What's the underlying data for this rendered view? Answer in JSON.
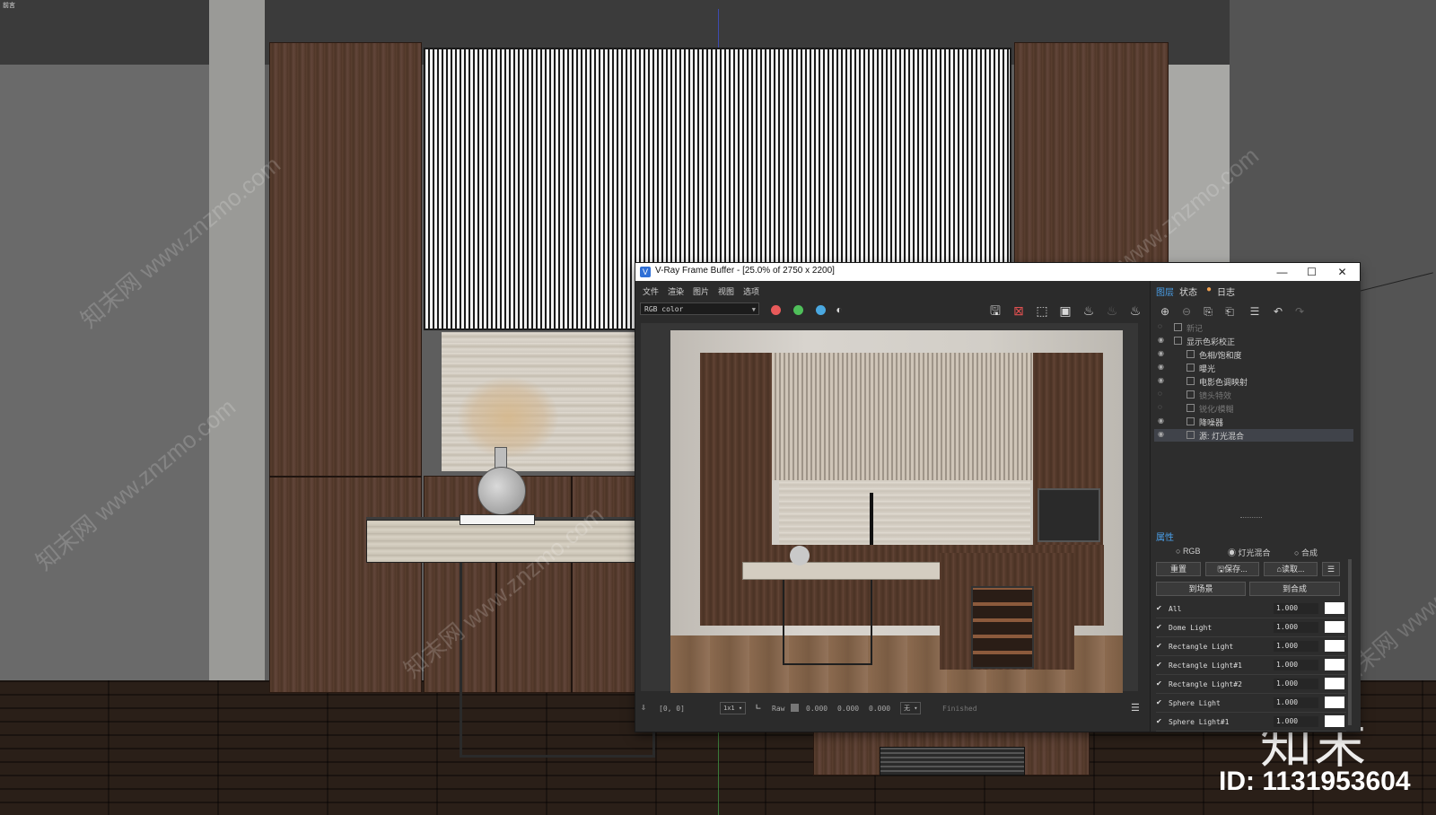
{
  "viewport": {
    "corner_label": "前言",
    "watermark_text": "知末网 www.znzmo.com",
    "logo_text": "知末",
    "id_text": "ID: 1131953604"
  },
  "vfb": {
    "title": "V-Ray Frame Buffer - [25.0% of 2750 x 2200]",
    "window_controls": {
      "minimize": "—",
      "maximize": "☐",
      "close": "✕"
    },
    "menu": [
      "文件",
      "渲染",
      "图片",
      "视图",
      "选项"
    ],
    "channel": "RGB color",
    "channel_dots": [
      "#e85a5a",
      "#4fbf5a",
      "#4aa8e0"
    ],
    "status": {
      "coords": "[0, 0]",
      "ratio": "1x1",
      "raw": "Raw",
      "v1": "0.000",
      "v2": "0.000",
      "v3": "0.000",
      "mode": "无",
      "state": "Finished"
    },
    "panel": {
      "tabs": [
        "图层",
        "状态",
        "日志"
      ],
      "layers": [
        {
          "name": "新记",
          "enabled": false,
          "indent": 1
        },
        {
          "name": "显示色彩校正",
          "enabled": true,
          "indent": 1
        },
        {
          "name": "色相/饱和度",
          "enabled": true,
          "indent": 2
        },
        {
          "name": "曝光",
          "enabled": true,
          "indent": 2
        },
        {
          "name": "电影色调映射",
          "enabled": true,
          "indent": 2
        },
        {
          "name": "镜头特效",
          "enabled": false,
          "indent": 2
        },
        {
          "name": "锐化/模糊",
          "enabled": false,
          "indent": 2
        },
        {
          "name": "降噪器",
          "enabled": true,
          "indent": 2
        },
        {
          "name": "源: 灯光混合",
          "enabled": true,
          "indent": 2,
          "selected": true
        }
      ],
      "properties_title": "属性",
      "radio": [
        "RGB",
        "灯光混合",
        "合成"
      ],
      "radio_selected": "灯光混合",
      "buttons": {
        "reset": "重置",
        "save": "保存...",
        "load": "读取...",
        "to_scene": "到场景",
        "to_composite": "到合成"
      },
      "lights": [
        {
          "name": "All",
          "value": "1.000"
        },
        {
          "name": "Dome Light",
          "value": "1.000"
        },
        {
          "name": "Rectangle Light",
          "value": "1.000"
        },
        {
          "name": "Rectangle Light#1",
          "value": "1.000"
        },
        {
          "name": "Rectangle Light#2",
          "value": "1.000"
        },
        {
          "name": "Sphere Light",
          "value": "1.000"
        },
        {
          "name": "Sphere Light#1",
          "value": "1.000"
        }
      ]
    }
  }
}
